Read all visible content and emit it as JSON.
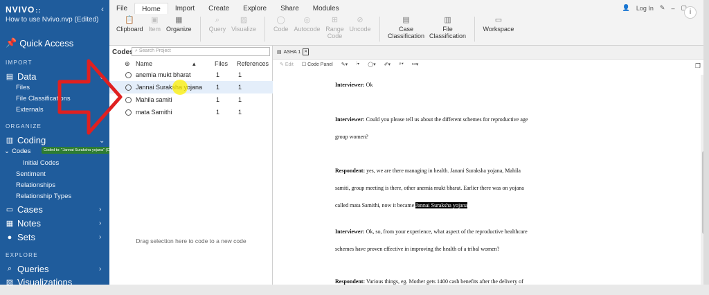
{
  "app": {
    "logo": "NVIVO",
    "logo_mark": "::",
    "project": "How to use Nvivo.nvp (Edited)"
  },
  "sidebar": {
    "quick_access": "Quick Access",
    "import_section": "IMPORT",
    "data": "Data",
    "data_items": [
      "Files",
      "File Classifications",
      "Externals"
    ],
    "organize_section": "ORGANIZE",
    "coding": "Coding",
    "codes": "Codes",
    "coding_items": [
      "Initial Codes",
      "Sentiment",
      "Relationships",
      "Relationship Types"
    ],
    "cases": "Cases",
    "notes": "Notes",
    "sets": "Sets",
    "explore_section": "EXPLORE",
    "queries": "Queries",
    "visualizations": "Visualizations",
    "tooltip": "Coded to: \"Jannai Suraksha yojana\" (Codes)"
  },
  "ribbon": {
    "tabs": [
      "File",
      "Home",
      "Import",
      "Create",
      "Explore",
      "Share",
      "Modules"
    ],
    "active_tab": "Home",
    "tools": {
      "clipboard": "Clipboard",
      "item": "Item",
      "organize": "Organize",
      "query": "Query",
      "visualize": "Visualize",
      "code": "Code",
      "autocode": "Autocode",
      "range_code": "Range Code",
      "uncode": "Uncode",
      "case_class": "Case Classification",
      "file_class": "File Classification",
      "workspace": "Workspace"
    },
    "login": "Log In"
  },
  "codes_panel": {
    "title": "Codes",
    "search_placeholder": "Search Project",
    "columns": {
      "name": "Name",
      "files": "Files",
      "refs": "References"
    },
    "rows": [
      {
        "name": "anemia mukt bharat",
        "files": "1",
        "refs": "1"
      },
      {
        "name": "Jannai Suraksha yojana",
        "files": "1",
        "refs": "1"
      },
      {
        "name": "Mahila samiti",
        "files": "1",
        "refs": "1"
      },
      {
        "name": "mata Samithi",
        "files": "1",
        "refs": "1"
      }
    ],
    "drop_hint": "Drag selection here to code to a new code"
  },
  "document": {
    "tab": "ASHA 1",
    "toolbar": {
      "edit": "Edit",
      "code_panel": "Code Panel"
    },
    "paras": [
      {
        "speaker": "Interviewer:",
        "lines": [
          "Ok"
        ]
      },
      {
        "speaker": "Interviewer:",
        "lines": [
          "Could you please tell us about the different schemes for reproductive age",
          "group women?"
        ]
      },
      {
        "speaker": "Respondent:",
        "lines": [
          "yes, we are there managing in health. Janani Suraksha yojana, Mahila",
          "samiti, group meeting is there, other anemia mukt bharat. Earlier there was on yojana",
          "called mata Samithi, now it became"
        ],
        "highlight": "Jannai Suraksha yojana"
      },
      {
        "speaker": "Interviewer:",
        "lines": [
          "Ok, so, from your experience, what aspect of the reproductive healthcare",
          "schemes have proven effective in improving the health of a tribal women?"
        ]
      },
      {
        "speaker": "Respondent:",
        "lines": [
          "Various things, eg. Mother gets 1400 cash benefits after the delivery of"
        ]
      }
    ]
  },
  "colors": {
    "sidebar": "#1f5c9c",
    "arrow": "#e02020",
    "selection": "#e4eefa",
    "tooltip": "#2e7d32"
  }
}
